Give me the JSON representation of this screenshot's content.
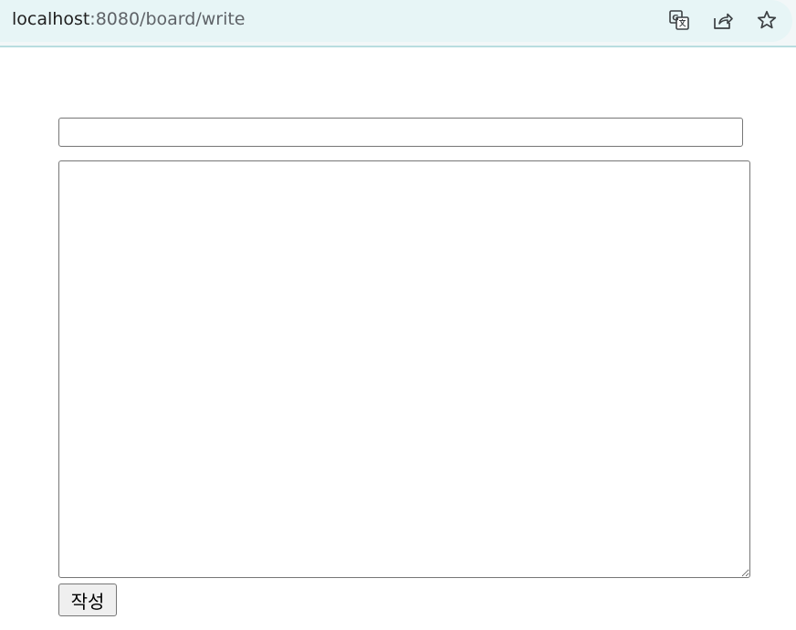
{
  "browser": {
    "url_host": "localhost",
    "url_rest": ":8080/board/write",
    "icons": [
      "translate-icon",
      "share-icon",
      "star-icon"
    ]
  },
  "form": {
    "title_value": "",
    "content_value": "",
    "submit_label": "작성"
  },
  "colors": {
    "address_bar_bg": "#e7f5f6",
    "address_bar_border": "#b9dde0",
    "button_bg": "#efefef",
    "field_border": "#767676"
  }
}
